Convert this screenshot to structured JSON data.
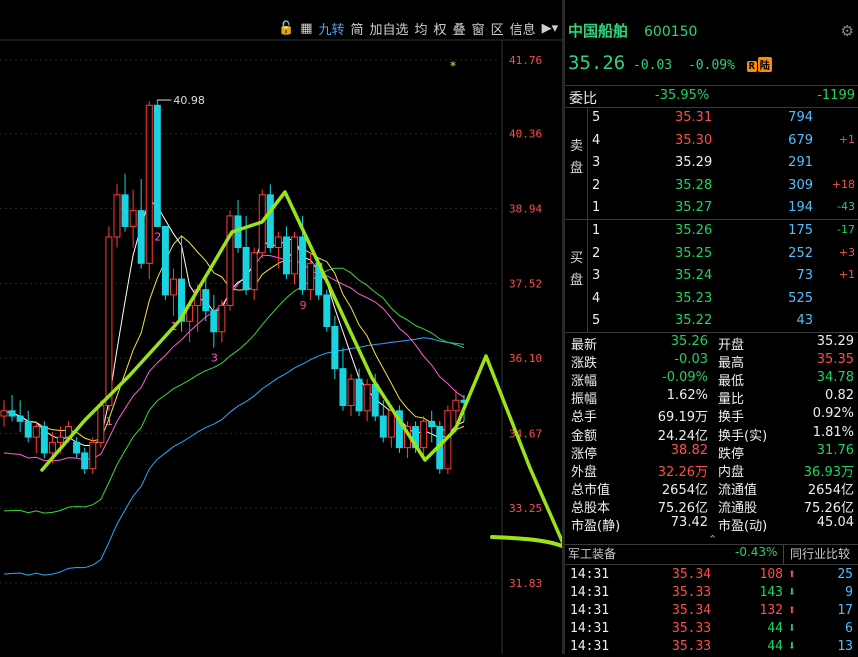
{
  "toolbar": {
    "items": [
      "九转",
      "简",
      "加自选",
      "均",
      "权",
      "叠",
      "窗",
      "区",
      "信息"
    ],
    "active_index": 0
  },
  "chart_data": {
    "type": "candlestick",
    "y_axis_ticks": [
      "41.76",
      "40.36",
      "38.94",
      "37.52",
      "36.10",
      "34.67",
      "33.25",
      "31.83"
    ],
    "ylim": [
      31.83,
      41.76
    ],
    "high_label": "40.98",
    "colors": {
      "up": "#ff3b3b",
      "down": "#19d4e0",
      "ma5": "#ffffff",
      "ma10": "#f2e14a",
      "ma20": "#ff5bd8",
      "ma30": "#3bd63b",
      "ma60": "#2aa8ff",
      "annotation": "#9be21a"
    },
    "candles": [
      [
        35.0,
        35.3,
        34.8,
        35.1
      ],
      [
        35.1,
        35.4,
        34.9,
        35.0
      ],
      [
        35.0,
        35.3,
        34.7,
        34.9
      ],
      [
        34.9,
        35.1,
        34.5,
        34.6
      ],
      [
        34.6,
        34.9,
        34.3,
        34.8
      ],
      [
        34.8,
        34.9,
        34.2,
        34.3
      ],
      [
        34.3,
        34.7,
        34.1,
        34.5
      ],
      [
        34.5,
        34.8,
        34.3,
        34.6
      ],
      [
        34.6,
        34.9,
        34.5,
        34.8
      ],
      [
        34.5,
        34.6,
        34.2,
        34.3
      ],
      [
        34.3,
        34.4,
        33.9,
        34.0
      ],
      [
        34.0,
        34.6,
        33.9,
        34.5
      ],
      [
        34.5,
        35.3,
        34.4,
        35.2
      ],
      [
        35.2,
        38.6,
        35.1,
        38.4
      ],
      [
        38.4,
        39.4,
        38.2,
        39.2
      ],
      [
        39.2,
        39.6,
        38.5,
        38.6
      ],
      [
        38.6,
        39.3,
        38.2,
        38.9
      ],
      [
        38.9,
        39.5,
        37.8,
        37.9
      ],
      [
        37.9,
        40.98,
        37.6,
        40.9
      ],
      [
        40.9,
        41.0,
        38.6,
        38.6
      ],
      [
        38.6,
        38.6,
        37.2,
        37.3
      ],
      [
        37.3,
        37.8,
        36.9,
        37.6
      ],
      [
        37.6,
        38.4,
        36.6,
        36.8
      ],
      [
        36.8,
        37.2,
        36.4,
        37.1
      ],
      [
        37.1,
        37.5,
        36.6,
        37.4
      ],
      [
        37.4,
        37.6,
        36.8,
        37.0
      ],
      [
        37.0,
        37.3,
        36.3,
        36.6
      ],
      [
        36.6,
        37.2,
        36.4,
        37.1
      ],
      [
        37.1,
        38.9,
        37.0,
        38.8
      ],
      [
        38.8,
        39.1,
        38.1,
        38.2
      ],
      [
        38.2,
        38.8,
        37.3,
        37.4
      ],
      [
        37.4,
        38.2,
        37.2,
        38.1
      ],
      [
        38.1,
        39.3,
        38.0,
        39.2
      ],
      [
        39.2,
        39.4,
        38.1,
        38.2
      ],
      [
        38.2,
        38.5,
        37.8,
        38.4
      ],
      [
        38.4,
        38.6,
        37.6,
        37.7
      ],
      [
        37.7,
        38.5,
        37.5,
        38.4
      ],
      [
        38.4,
        38.8,
        37.3,
        37.4
      ],
      [
        37.4,
        38.1,
        37.2,
        37.9
      ],
      [
        37.9,
        38.0,
        37.2,
        37.3
      ],
      [
        37.3,
        37.4,
        36.6,
        36.7
      ],
      [
        36.7,
        36.9,
        35.7,
        35.9
      ],
      [
        35.9,
        36.3,
        35.1,
        35.2
      ],
      [
        35.2,
        35.8,
        35.0,
        35.7
      ],
      [
        35.7,
        35.9,
        35.0,
        35.1
      ],
      [
        35.1,
        35.7,
        34.9,
        35.6
      ],
      [
        35.6,
        35.8,
        34.9,
        35.0
      ],
      [
        35.0,
        35.3,
        34.5,
        34.6
      ],
      [
        34.6,
        35.2,
        34.4,
        35.1
      ],
      [
        35.1,
        35.2,
        34.3,
        34.4
      ],
      [
        34.4,
        34.9,
        34.2,
        34.8
      ],
      [
        34.8,
        34.9,
        34.3,
        34.4
      ],
      [
        34.4,
        35.0,
        34.2,
        34.9
      ],
      [
        34.9,
        35.1,
        34.5,
        34.8
      ],
      [
        34.8,
        34.9,
        33.9,
        34.0
      ],
      [
        34.0,
        35.2,
        33.9,
        35.1
      ],
      [
        35.1,
        35.5,
        34.7,
        35.3
      ],
      [
        35.3,
        35.4,
        34.9,
        35.26
      ]
    ],
    "sequence_labels": [
      {
        "text": "1",
        "i": 13,
        "pos": "below"
      },
      {
        "text": "2",
        "i": 19,
        "pos": "below"
      },
      {
        "text": "1",
        "i": 21,
        "pos": "below"
      },
      {
        "text": "3",
        "i": 26,
        "pos": "below"
      },
      {
        "text": "9",
        "i": 37,
        "pos": "below"
      }
    ]
  },
  "stock": {
    "name": "中国船舶",
    "code": "600150",
    "price": "35.26",
    "change": "-0.03",
    "change_pct": "-0.09%",
    "badges": [
      "R",
      "陆"
    ]
  },
  "order_book": {
    "ratio_label": "委比",
    "ratio_pct": "-35.95%",
    "ratio_diff": "-1199",
    "sell_label": "卖盘",
    "buy_label": "买盘",
    "asks": [
      {
        "level": "5",
        "price": "35.31",
        "vol": "794",
        "chg": ""
      },
      {
        "level": "4",
        "price": "35.30",
        "vol": "679",
        "chg": "+1"
      },
      {
        "level": "3",
        "price": "35.29",
        "vol": "291",
        "chg": ""
      },
      {
        "level": "2",
        "price": "35.28",
        "vol": "309",
        "chg": "+18"
      },
      {
        "level": "1",
        "price": "35.27",
        "vol": "194",
        "chg": "-43"
      }
    ],
    "bids": [
      {
        "level": "1",
        "price": "35.26",
        "vol": "175",
        "chg": "-17"
      },
      {
        "level": "2",
        "price": "35.25",
        "vol": "252",
        "chg": "+3"
      },
      {
        "level": "3",
        "price": "35.24",
        "vol": "73",
        "chg": "+1"
      },
      {
        "level": "4",
        "price": "35.23",
        "vol": "525",
        "chg": ""
      },
      {
        "level": "5",
        "price": "35.22",
        "vol": "43",
        "chg": ""
      }
    ]
  },
  "stats": [
    {
      "l": "最新",
      "v": "35.26",
      "vc": "green",
      "l2": "开盘",
      "v2": "35.29",
      "v2c": "white"
    },
    {
      "l": "涨跌",
      "v": "-0.03",
      "vc": "green",
      "l2": "最高",
      "v2": "35.35",
      "v2c": "red"
    },
    {
      "l": "涨幅",
      "v": "-0.09%",
      "vc": "green",
      "l2": "最低",
      "v2": "34.78",
      "v2c": "green"
    },
    {
      "l": "振幅",
      "v": "1.62%",
      "vc": "white",
      "l2": "量比",
      "v2": "0.82",
      "v2c": "white"
    },
    {
      "l": "总手",
      "v": "69.19万",
      "vc": "white",
      "l2": "换手",
      "v2": "0.92%",
      "v2c": "white"
    },
    {
      "l": "金额",
      "v": "24.24亿",
      "vc": "white",
      "l2": "换手(实)",
      "v2": "1.81%",
      "v2c": "white"
    },
    {
      "l": "涨停",
      "v": "38.82",
      "vc": "red",
      "l2": "跌停",
      "v2": "31.76",
      "v2c": "green"
    },
    {
      "l": "外盘",
      "v": "32.26万",
      "vc": "red",
      "l2": "内盘",
      "v2": "36.93万",
      "v2c": "green"
    },
    {
      "l": "总市值",
      "v": "2654亿",
      "vc": "white",
      "l2": "流通值",
      "v2": "2654亿",
      "v2c": "white"
    },
    {
      "l": "总股本",
      "v": "75.26亿",
      "vc": "white",
      "l2": "流通股",
      "v2": "75.26亿",
      "v2c": "white"
    },
    {
      "l": "市盈(静)",
      "v": "73.42",
      "vc": "white",
      "l2": "市盈(动)",
      "v2": "45.04",
      "v2c": "white"
    }
  ],
  "sector": {
    "name": "军工装备",
    "pct": "-0.43%",
    "compare": "同行业比较"
  },
  "ticks": [
    {
      "time": "14:31",
      "price": "35.34",
      "vol": "108",
      "dir": "up",
      "n": "25"
    },
    {
      "time": "14:31",
      "price": "35.33",
      "vol": "143",
      "dir": "down",
      "n": "9"
    },
    {
      "time": "14:31",
      "price": "35.34",
      "vol": "132",
      "dir": "up",
      "n": "17"
    },
    {
      "time": "14:31",
      "price": "35.33",
      "vol": "44",
      "dir": "down",
      "n": "6"
    },
    {
      "time": "14:31",
      "price": "35.33",
      "vol": "44",
      "dir": "down",
      "n": "13"
    }
  ]
}
